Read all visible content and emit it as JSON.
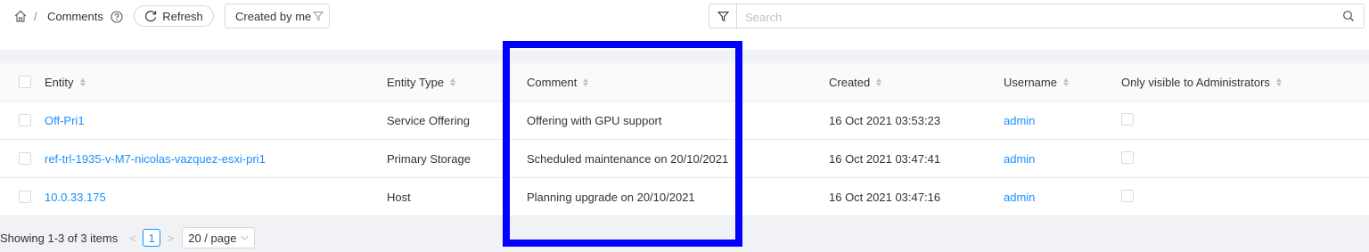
{
  "breadcrumb": {
    "separator": "/",
    "title": "Comments"
  },
  "toolbar": {
    "refresh_label": "Refresh",
    "filter_label": "Created by me"
  },
  "search": {
    "placeholder": "Search"
  },
  "table": {
    "columns": [
      "Entity",
      "Entity Type",
      "Comment",
      "Created",
      "Username",
      "Only visible to Administrators"
    ],
    "rows": [
      {
        "entity": "Off-Pri1",
        "entity_type": "Service Offering",
        "comment": "Offering with GPU support",
        "created": "16 Oct 2021 03:53:23",
        "username": "admin",
        "admin_only": false
      },
      {
        "entity": "ref-trl-1935-v-M7-nicolas-vazquez-esxi-pri1",
        "entity_type": "Primary Storage",
        "comment": "Scheduled maintenance on 20/10/2021",
        "created": "16 Oct 2021 03:47:41",
        "username": "admin",
        "admin_only": false
      },
      {
        "entity": "10.0.33.175",
        "entity_type": "Host",
        "comment": "Planning upgrade on 20/10/2021",
        "created": "16 Oct 2021 03:47:16",
        "username": "admin",
        "admin_only": false
      }
    ]
  },
  "pagination": {
    "total_text": "Showing 1-3 of 3 items",
    "prev": "<",
    "current_page": "1",
    "next": ">",
    "page_size": "20 / page"
  },
  "colors": {
    "link": "#1890ff",
    "highlight": "#0000ff"
  }
}
